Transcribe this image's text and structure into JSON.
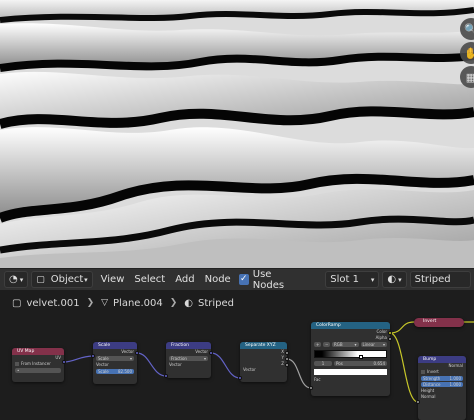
{
  "header": {
    "mode_label": "Object",
    "menus": [
      "View",
      "Select",
      "Add",
      "Node"
    ],
    "use_nodes_label": "Use Nodes",
    "slot_label": "Slot 1",
    "material_label": "Striped"
  },
  "breadcrumb": {
    "object": "velvet.001",
    "mesh": "Plane.004",
    "material": "Striped"
  },
  "nodes": {
    "uvmap": {
      "title": "UV Map",
      "output": "UV",
      "from_instancer": "From Instancer"
    },
    "scale": {
      "title": "Scale",
      "out": "Vector",
      "op": "Scale",
      "in_vector": "Vector",
      "scale_label": "Scale",
      "scale_value": "82.500"
    },
    "fraction": {
      "title": "Fraction",
      "out": "Vector",
      "op": "Fraction",
      "in_vector": "Vector"
    },
    "separate": {
      "title": "Separate XYZ",
      "x": "X",
      "y": "Y",
      "z": "Z",
      "in_vector": "Vector"
    },
    "colorramp": {
      "title": "ColorRamp",
      "color": "Color",
      "alpha": "Alpha",
      "mode": "RGB",
      "interp": "Linear",
      "stop_index": "1",
      "pos_label": "Pos",
      "pos_value": "0.654",
      "fac": "Fac"
    },
    "invert": {
      "title": "Invert"
    },
    "bump": {
      "title": "Bump",
      "normal_out": "Normal",
      "invert": "Invert",
      "strength_label": "Strength",
      "strength_value": "1.000",
      "distance_label": "Distance",
      "distance_value": "1.000",
      "height": "Height",
      "normal_in": "Normal"
    }
  },
  "colors": {
    "accent": "#4772b3",
    "node_vector_header": "#3c3c83",
    "node_input_header": "#83314a",
    "node_converter_header": "#246283",
    "socket_vector": "#6363c7",
    "socket_color": "#c7c729"
  }
}
